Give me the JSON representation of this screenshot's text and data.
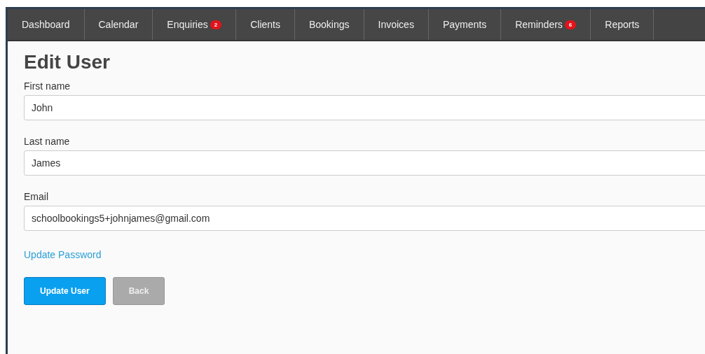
{
  "nav": [
    {
      "label": "Dashboard"
    },
    {
      "label": "Calendar"
    },
    {
      "label": "Enquiries",
      "badge": "2"
    },
    {
      "label": "Clients"
    },
    {
      "label": "Bookings"
    },
    {
      "label": "Invoices"
    },
    {
      "label": "Payments"
    },
    {
      "label": "Reminders",
      "badge": "6"
    },
    {
      "label": "Reports"
    }
  ],
  "title": "Edit User",
  "fields": [
    {
      "label": "First name",
      "value": "John"
    },
    {
      "label": "Last name",
      "value": "James"
    },
    {
      "label": "Email",
      "value": "schoolbookings5+johnjames@gmail.com"
    }
  ],
  "link": "Update Password",
  "buttons": [
    {
      "label": "Update User",
      "kind": "primary"
    },
    {
      "label": "Back",
      "kind": "secondary"
    }
  ]
}
